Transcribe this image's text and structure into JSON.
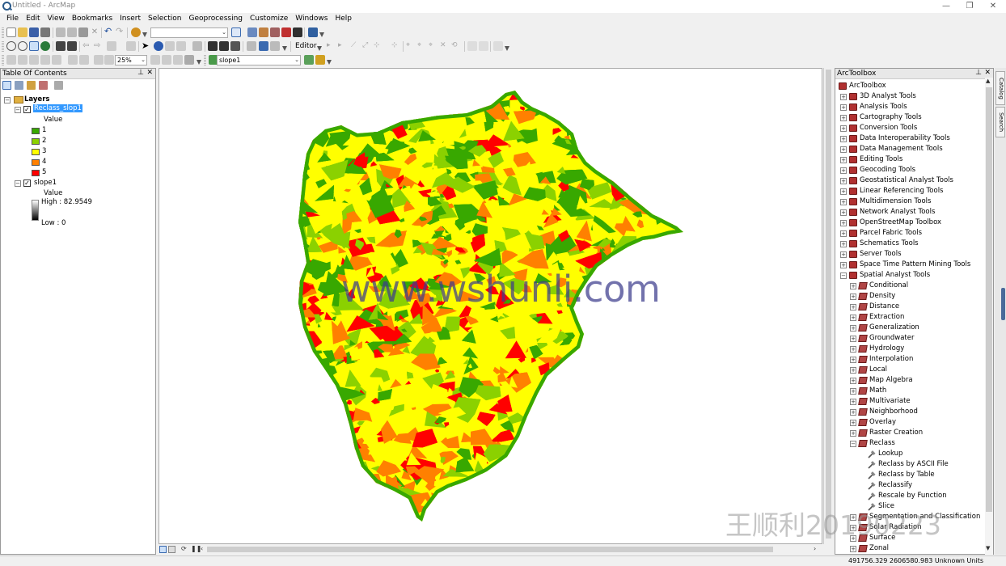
{
  "window": {
    "title": "Untitled - ArcMap",
    "min": "—",
    "max": "❐",
    "close": "✕"
  },
  "menu": [
    "File",
    "Edit",
    "View",
    "Bookmarks",
    "Insert",
    "Selection",
    "Geoprocessing",
    "Customize",
    "Windows",
    "Help"
  ],
  "toolbar": {
    "editor_label": "Editor",
    "zoom_value": "25%",
    "layer_combo": "slope1",
    "scale_combo": ""
  },
  "toc": {
    "title": "Table Of Contents",
    "pin": "📌",
    "close": "✕",
    "root": "Layers",
    "layer1": {
      "name": "Reclass_slop1",
      "field": "Value",
      "classes": [
        {
          "label": "1",
          "color": "#38a800"
        },
        {
          "label": "2",
          "color": "#8bd100"
        },
        {
          "label": "3",
          "color": "#ffff00"
        },
        {
          "label": "4",
          "color": "#ff8000"
        },
        {
          "label": "5",
          "color": "#ff0000"
        }
      ]
    },
    "layer2": {
      "name": "slope1",
      "field": "Value",
      "high": "High : 82.9549",
      "low": "Low : 0"
    }
  },
  "toolbox": {
    "title": "ArcToolbox",
    "root": "ArcToolbox",
    "toolsets": [
      "3D Analyst Tools",
      "Analysis Tools",
      "Cartography Tools",
      "Conversion Tools",
      "Data Interoperability Tools",
      "Data Management Tools",
      "Editing Tools",
      "Geocoding Tools",
      "Geostatistical Analyst Tools",
      "Linear Referencing Tools",
      "Multidimension Tools",
      "Network Analyst Tools",
      "OpenStreetMap Toolbox",
      "Parcel Fabric Tools",
      "Schematics Tools",
      "Server Tools",
      "Space Time Pattern Mining Tools",
      "Spatial Analyst Tools"
    ],
    "spatial_children": [
      "Conditional",
      "Density",
      "Distance",
      "Extraction",
      "Generalization",
      "Groundwater",
      "Hydrology",
      "Interpolation",
      "Local",
      "Map Algebra",
      "Math",
      "Multivariate",
      "Neighborhood",
      "Overlay",
      "Raster Creation",
      "Reclass"
    ],
    "reclass_tools": [
      "Lookup",
      "Reclass by ASCII File",
      "Reclass by Table",
      "Reclassify",
      "Rescale by Function",
      "Slice"
    ],
    "after_reclass": [
      "Segmentation and Classification",
      "Solar Radiation",
      "Surface",
      "Zonal"
    ]
  },
  "side_tabs": [
    "Catalog",
    "Search"
  ],
  "status": {
    "coords": "491756.329  2606580.983 Unknown Units"
  },
  "watermarks": {
    "site": "www.wshunli.com",
    "author": "王顺利20190223"
  },
  "colors": {
    "class1": "#38a800",
    "class2": "#8bd100",
    "class3": "#ffff00",
    "class4": "#ff8000",
    "class5": "#ff0000",
    "selection": "#3399ff"
  }
}
